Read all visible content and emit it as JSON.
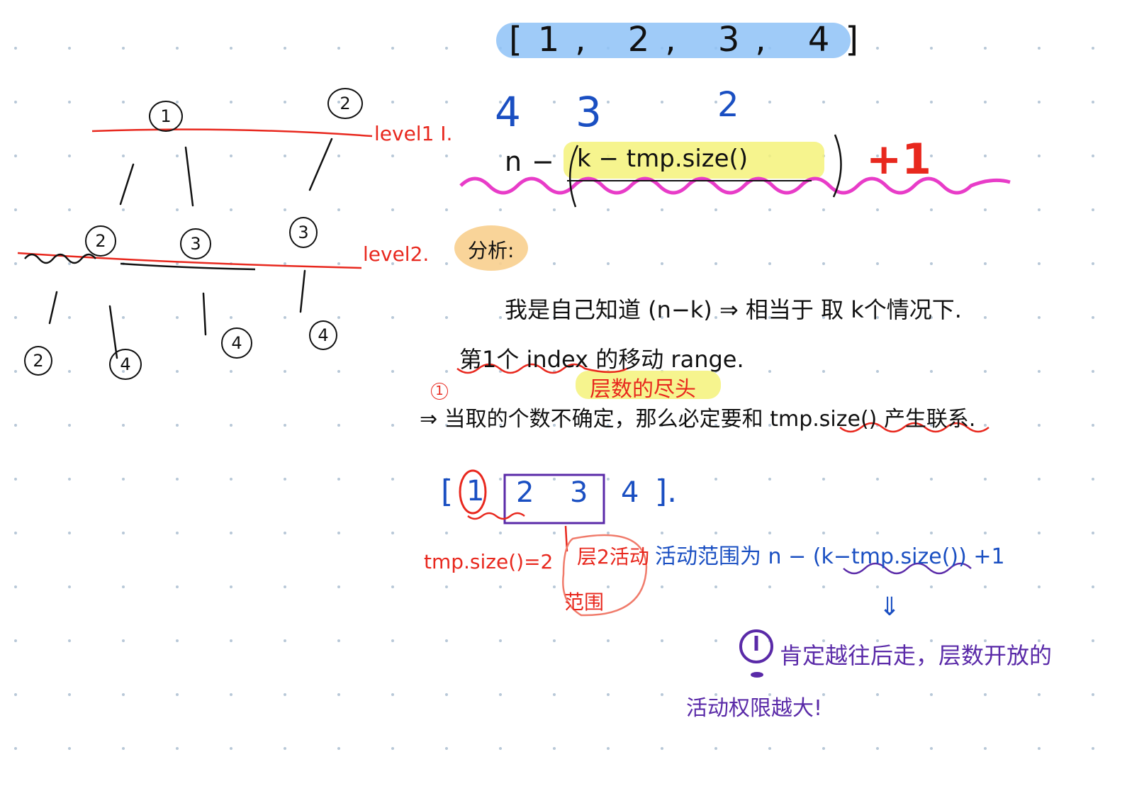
{
  "array_title": "[1, 2, 3, 4]",
  "tree": {
    "roots": [
      "1",
      "2"
    ],
    "level2": [
      "2",
      "3",
      "3"
    ],
    "level3": [
      "2",
      "4",
      "4",
      "4"
    ],
    "level1_label": "level1 I.",
    "level2_label": "level2."
  },
  "formula": {
    "n": "n",
    "minus": "−",
    "inner": "k − tmp.size()",
    "plus": "+1",
    "annot_4": "4",
    "annot_3": "3",
    "annot_2": "2"
  },
  "analysis": {
    "tag": "分析:",
    "line1": "我是自己知道 (n−k) ⇒ 相当于 取 k个情况下.",
    "line2": "第1个 index 的移动 range.",
    "highlight": "层数的尽头",
    "circle_num": "1",
    "line3_prefix": "⇒ 当取的个数不确定，那么必定要和",
    "line3_link": "tmp.size()",
    "line3_suffix": "产生联系."
  },
  "example": {
    "open": "[",
    "e1": "1",
    "e2": "2",
    "e3": "3",
    "e4": "4",
    "close": "].",
    "tmp_size": "tmp.size()=2",
    "layer2": "层2活动",
    "range": "范围",
    "active_range": "活动范围为 n − (k−tmp.size()) +1",
    "arrow": "⇓",
    "conclusion1": "肯定越往后走，层数开放的",
    "conclusion2": "活动权限越大!"
  },
  "colors": {
    "red": "#e8281e",
    "blue": "#1a4fc2",
    "purple": "#5a2aa8",
    "magenta": "#e83cc8",
    "highlight_blue": "#8ec2f7",
    "highlight_yellow": "#f4f27a",
    "highlight_orange": "#f8cf8e",
    "dots": "#b8c8d8"
  }
}
